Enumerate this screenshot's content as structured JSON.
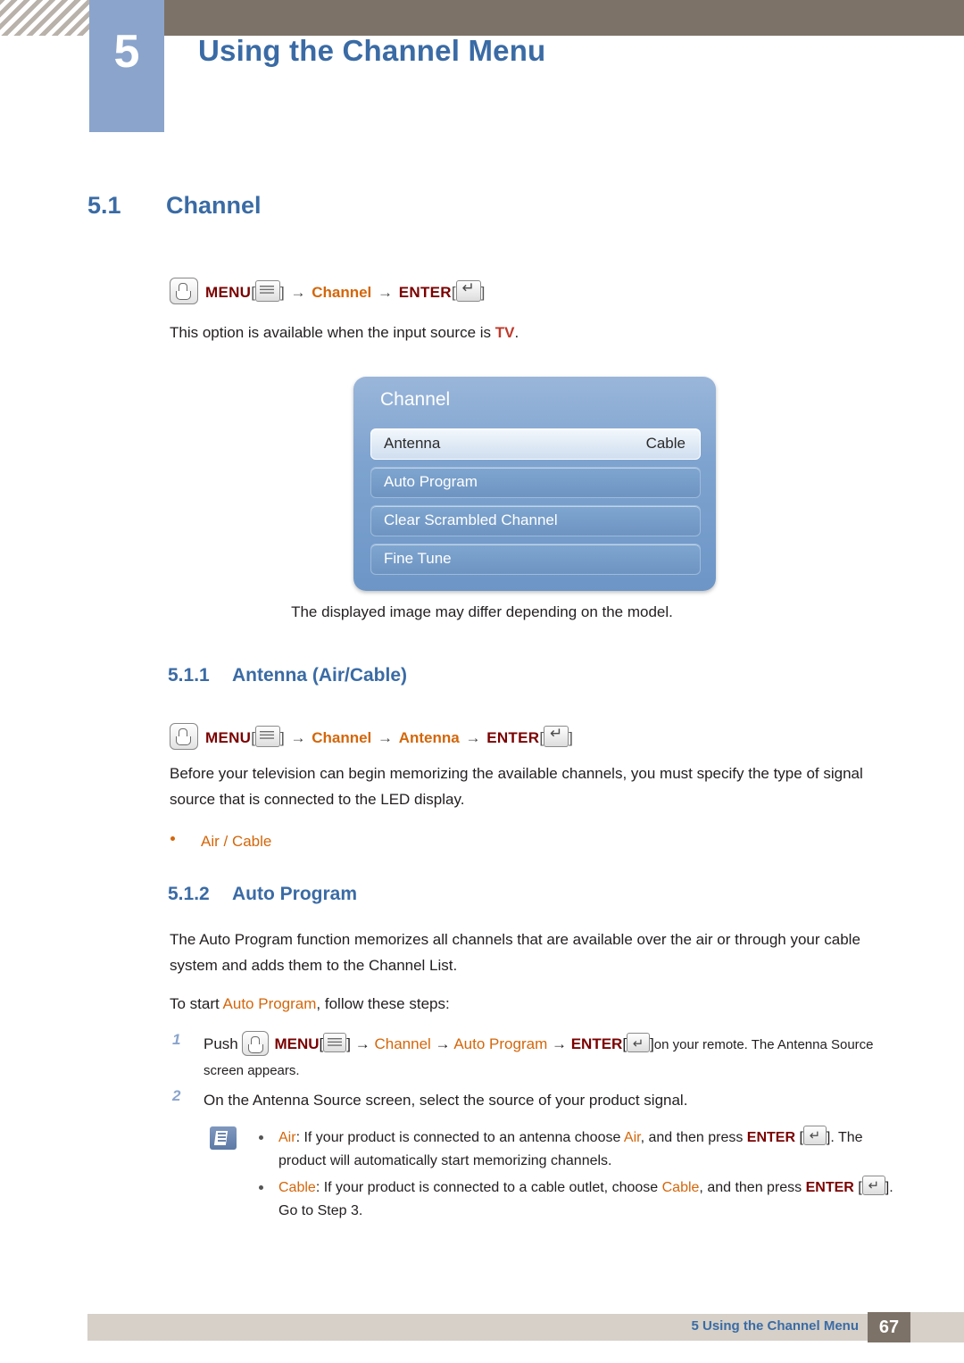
{
  "header": {
    "chapter_number": "5",
    "chapter_title": "Using the Channel Menu"
  },
  "section": {
    "number": "5.1",
    "title": "Channel"
  },
  "path1": {
    "menu": "MENU",
    "arrow": "→",
    "channel": "Channel",
    "enter": "ENTER",
    "bracket_open": "[",
    "bracket_close": "]"
  },
  "intro_text": {
    "before": "This option is available when the input source is ",
    "tv": "TV",
    "after": "."
  },
  "osd": {
    "title": "Channel",
    "rows": [
      {
        "label": "Antenna",
        "value": "Cable",
        "selected": true
      },
      {
        "label": "Auto Program",
        "value": "",
        "selected": false
      },
      {
        "label": "Clear Scrambled Channel",
        "value": "",
        "selected": false
      },
      {
        "label": "Fine Tune",
        "value": "",
        "selected": false
      }
    ],
    "caption": "The displayed image may differ depending on the model."
  },
  "sub1": {
    "number": "5.1.1",
    "title": "Antenna (Air/Cable)",
    "path": {
      "menu": "MENU",
      "arrow": "→",
      "channel": "Channel",
      "antenna": "Antenna",
      "enter": "ENTER",
      "bracket_open": "[",
      "bracket_close": "]"
    },
    "paragraph": "Before your television can begin memorizing the available channels, you must specify the type of signal source that is connected to the LED display.",
    "bullet": "Air / Cable"
  },
  "sub2": {
    "number": "5.1.2",
    "title": "Auto Program",
    "paragraph": "The Auto Program function memorizes all channels that are available over the air or through your cable system and adds them to the Channel List.",
    "start_line": {
      "before": "To start ",
      "highlight": "Auto Program",
      "after": ", follow these steps:"
    },
    "steps": [
      {
        "num": "1",
        "push": "Push",
        "menu": "MENU",
        "arrow": "→",
        "channel": "Channel",
        "auto_program": "Auto Program",
        "enter": "ENTER",
        "tail": "on your remote. The Antenna Source screen appears.",
        "bracket_open": "[",
        "bracket_close": "]"
      },
      {
        "num": "2",
        "text": "On the Antenna Source screen, select the source of your product signal."
      }
    ],
    "notes": [
      {
        "term": "Air",
        "body_before": ": If your product is connected to an antenna choose ",
        "term2": "Air",
        "body_mid": ", and then press ",
        "enter": "ENTER",
        "body_after": ". The product will automatically start memorizing channels.",
        "bracket_open": "[",
        "bracket_close": "]"
      },
      {
        "term": "Cable",
        "body_before": ": If your product is connected to a cable outlet, choose ",
        "term2": "Cable",
        "body_mid": ", and then press ",
        "enter": "ENTER",
        "body_after": ". Go to Step 3.",
        "bracket_open": "[",
        "bracket_close": "]"
      }
    ]
  },
  "footer": {
    "text": "5 Using the Channel Menu",
    "page": "67"
  }
}
